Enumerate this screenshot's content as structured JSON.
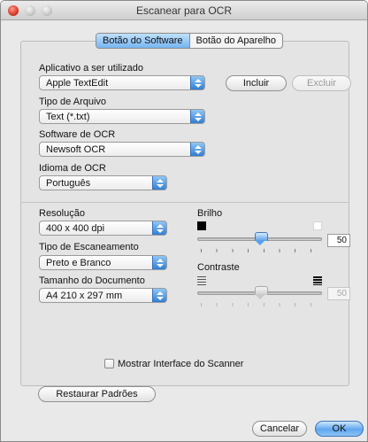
{
  "window": {
    "title": "Escanear para OCR"
  },
  "tabs": [
    {
      "label": "Botão do Software",
      "active": true
    },
    {
      "label": "Botão do Aparelho",
      "active": false
    }
  ],
  "app": {
    "label": "Aplicativo a ser utilizado",
    "value": "Apple TextEdit",
    "add_button": "Incluir",
    "remove_button": "Excluir"
  },
  "file_type": {
    "label": "Tipo de Arquivo",
    "value": "Text (*.txt)"
  },
  "ocr_software": {
    "label": "Software de OCR",
    "value": "Newsoft OCR"
  },
  "ocr_language": {
    "label": "Idioma de OCR",
    "value": "Português"
  },
  "resolution": {
    "label": "Resolução",
    "value": "400 x 400 dpi"
  },
  "scan_type": {
    "label": "Tipo de Escaneamento",
    "value": "Preto e Branco"
  },
  "document_size": {
    "label": "Tamanho do Documento",
    "value": "A4 210 x 297 mm"
  },
  "brightness": {
    "label": "Brilho",
    "value": "50",
    "level": 0.5
  },
  "contrast": {
    "label": "Contraste",
    "value": "50",
    "level": 0.5,
    "enabled": false
  },
  "show_interface": {
    "label": "Mostrar Interface do Scanner",
    "checked": false
  },
  "buttons": {
    "restore": "Restaurar Padrões",
    "cancel": "Cancelar",
    "ok": "OK"
  },
  "colors": {
    "accent": "#5fa6ee",
    "window_bg": "#e9e9e9"
  }
}
